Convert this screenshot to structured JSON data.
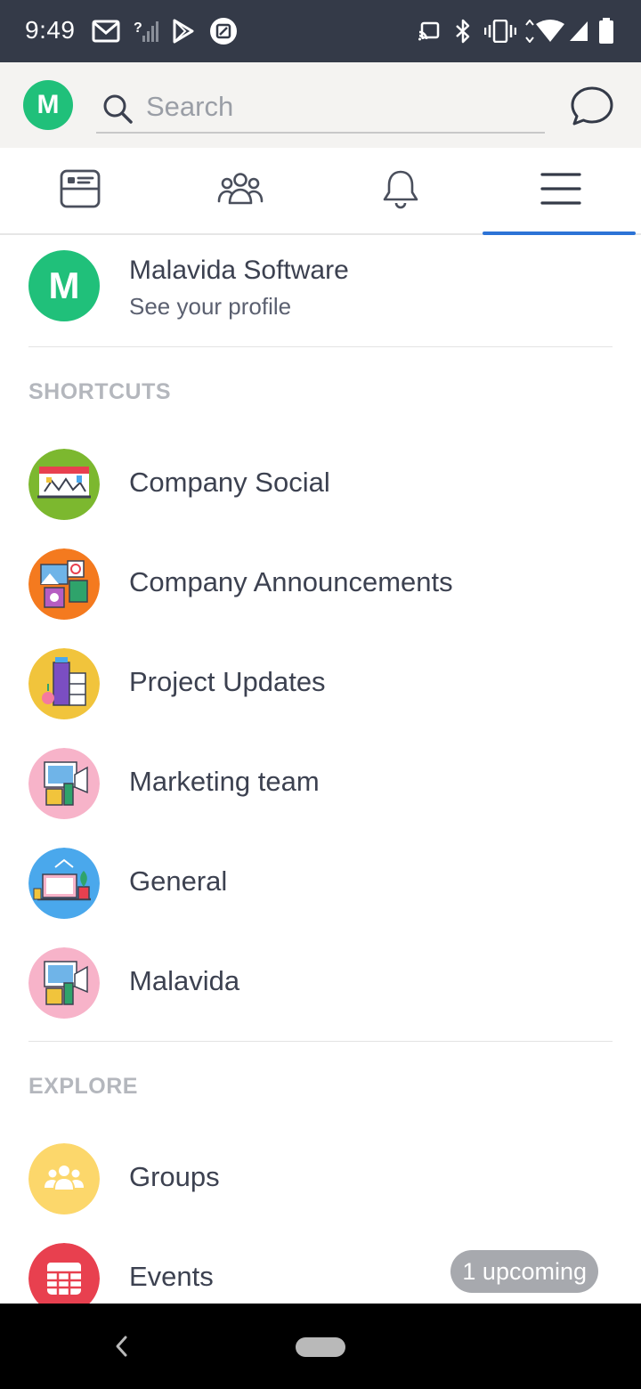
{
  "status_bar": {
    "time": "9:49",
    "icons": [
      "gmail-icon",
      "no-signal-icon",
      "play-store-icon",
      "screenshot-icon",
      "cast-icon",
      "bluetooth-icon",
      "vibrate-icon",
      "wifi-icon",
      "signal-icon",
      "battery-icon"
    ]
  },
  "header": {
    "avatar_letter": "M",
    "avatar_color": "#20c07a",
    "search_placeholder": "Search"
  },
  "tabs": [
    {
      "icon": "news-feed-icon",
      "active": false
    },
    {
      "icon": "people-icon",
      "active": false
    },
    {
      "icon": "bell-icon",
      "active": false
    },
    {
      "icon": "menu-icon",
      "active": true
    }
  ],
  "accent_color": "#2c73d6",
  "profile": {
    "avatar_letter": "M",
    "name": "Malavida Software",
    "subtitle": "See your profile"
  },
  "shortcuts": {
    "heading": "SHORTCUTS",
    "items": [
      {
        "label": "Company Social",
        "color": "#7cb82f"
      },
      {
        "label": "Company Announcements",
        "color": "#f47a1f"
      },
      {
        "label": "Project Updates",
        "color": "#f1c43c"
      },
      {
        "label": "Marketing team",
        "color": "#f7b3c9"
      },
      {
        "label": "General",
        "color": "#4aa8ec"
      },
      {
        "label": "Malavida",
        "color": "#f7b3c9"
      }
    ]
  },
  "explore": {
    "heading": "EXPLORE",
    "items": [
      {
        "label": "Groups",
        "color": "#fcd76b",
        "icon": "groups-icon"
      },
      {
        "label": "Events",
        "color": "#e8404f",
        "icon": "calendar-icon",
        "badge": "1 upcoming"
      }
    ]
  }
}
